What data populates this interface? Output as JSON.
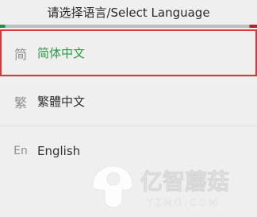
{
  "dialog": {
    "title": "请选择语言/Select Language"
  },
  "languages": [
    {
      "icon": "简",
      "label": "简体中文",
      "selected": true
    },
    {
      "icon": "繁",
      "label": "繁體中文",
      "selected": false
    },
    {
      "icon": "En",
      "label": "English",
      "selected": false
    }
  ],
  "watermark": {
    "brand": "亿智蘑菇",
    "domain": "YZMG.COM"
  },
  "colors": {
    "accent_green": "#2e9648",
    "accent_red": "#d33a3a",
    "background": "#efefef"
  }
}
